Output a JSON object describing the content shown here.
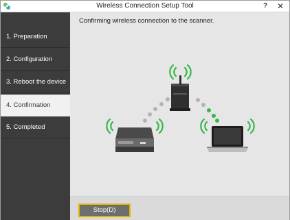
{
  "window": {
    "title": "Wireless Connection Setup Tool",
    "help_label": "?",
    "close_label": "✕"
  },
  "sidebar": {
    "steps": [
      {
        "label": "1. Preparation",
        "active": false
      },
      {
        "label": "2. Configuration",
        "active": false
      },
      {
        "label": "3. Reboot the device",
        "active": false
      },
      {
        "label": "4. Confirmation",
        "active": true
      },
      {
        "label": "5. Completed",
        "active": false
      }
    ]
  },
  "main": {
    "message": "Confirming wireless connection to the scanner."
  },
  "footer": {
    "stop_label": "Stop(D)"
  },
  "colors": {
    "sidebar_bg": "#3c3c3c",
    "wifi_green": "#39b54a",
    "dot_gray": "#b3b3b3",
    "button_border": "#e2b400"
  },
  "icons": [
    "app-icon",
    "wifi-icon",
    "router-icon",
    "scanner-icon",
    "laptop-icon"
  ]
}
